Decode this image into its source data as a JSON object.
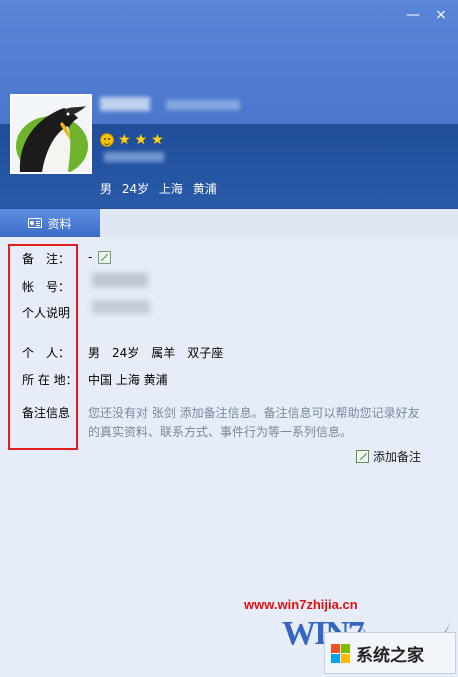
{
  "window": {
    "minimize_glyph": "—",
    "close_glyph": "×"
  },
  "profile": {
    "summary": "男 24岁 上海 黄浦",
    "stars": [
      "★",
      "★",
      "★"
    ]
  },
  "tab": {
    "label": "资料",
    "icon": "contact-card-icon"
  },
  "fields": {
    "remark": {
      "label": "备　注：",
      "value": "-"
    },
    "account": {
      "label": "帐　号：",
      "value": ""
    },
    "signature": {
      "label": "个人说明",
      "value": ""
    },
    "personal": {
      "label": "个　人：",
      "value": "男　24岁　属羊　双子座"
    },
    "location": {
      "label": "所 在 地：",
      "value": "中国 上海 黄浦"
    },
    "note": {
      "label": "备注信息",
      "hint": "您还没有对 张剑 添加备注信息。备注信息可以帮助您记录好友的真实资料、联系方式、事件行为等一系列信息。"
    }
  },
  "add_note_button": "添加备注",
  "watermark": {
    "url": "www.win7zhijia.cn",
    "win_text": "WIN7",
    "brand": "系统之家"
  },
  "colors": {
    "header": "#4a77cc",
    "highlight_box": "#e02020",
    "content_bg": "#e6edf8"
  }
}
